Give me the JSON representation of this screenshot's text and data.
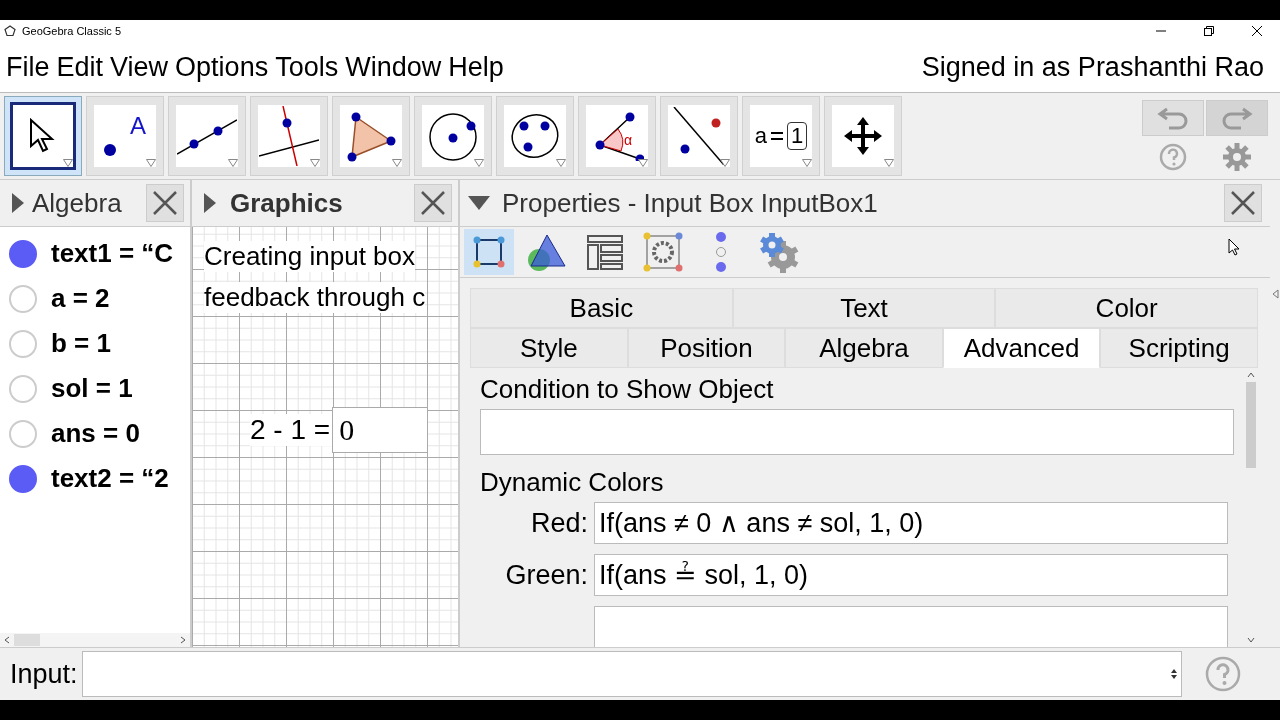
{
  "window": {
    "title": "GeoGebra Classic 5"
  },
  "menu": [
    "File",
    "Edit",
    "View",
    "Options",
    "Tools",
    "Window",
    "Help"
  ],
  "signed_in": "Signed in as Prashanthi Rao",
  "tools": [
    {
      "kind": "move",
      "selected": true
    },
    {
      "kind": "point",
      "label": "A",
      "selected": false
    },
    {
      "kind": "line",
      "selected": false
    },
    {
      "kind": "perpendicular",
      "selected": false
    },
    {
      "kind": "polygon",
      "selected": false
    },
    {
      "kind": "circle",
      "selected": false
    },
    {
      "kind": "conic",
      "selected": false
    },
    {
      "kind": "angle",
      "label": "α",
      "selected": false
    },
    {
      "kind": "reflect",
      "selected": false
    },
    {
      "kind": "slider",
      "label": "a",
      "value": "1",
      "selected": false
    },
    {
      "kind": "pan",
      "selected": false
    }
  ],
  "algebra": {
    "title": "Algebra",
    "items": [
      {
        "text": "text1 = “C",
        "visible": true
      },
      {
        "text": "a = 2",
        "visible": false
      },
      {
        "text": "b = 1",
        "visible": false
      },
      {
        "text": "sol = 1",
        "visible": false
      },
      {
        "text": "ans = 0",
        "visible": false
      },
      {
        "text": "text2 = “2",
        "visible": true
      }
    ]
  },
  "graphics": {
    "title": "Graphics",
    "lines": [
      "Creating input box",
      "feedback through c"
    ],
    "caption": "2 - 1 =",
    "input_value": "0"
  },
  "properties": {
    "title": "Properties - Input Box InputBox1",
    "views": [
      {
        "kind": "object",
        "selected": true
      },
      {
        "kind": "graphics",
        "selected": false
      },
      {
        "kind": "layout",
        "selected": false
      },
      {
        "kind": "defaults",
        "selected": false
      },
      {
        "kind": "algebra",
        "selected": false
      },
      {
        "kind": "advanced",
        "selected": false
      }
    ],
    "tab_rows": [
      [
        {
          "label": "Basic",
          "selected": false
        },
        {
          "label": "Text",
          "selected": false
        },
        {
          "label": "Color",
          "selected": false
        }
      ],
      [
        {
          "label": "Style",
          "selected": false
        },
        {
          "label": "Position",
          "selected": false
        },
        {
          "label": "Algebra",
          "selected": false
        },
        {
          "label": "Advanced",
          "selected": true
        },
        {
          "label": "Scripting",
          "selected": false
        }
      ]
    ],
    "condition_title": "Condition to Show Object",
    "dynamic_title": "Dynamic Colors",
    "colors": [
      {
        "label": "Red:",
        "value": "If(ans ≠ 0 ∧ ans ≠ sol, 1, 0)"
      },
      {
        "label": "Green:",
        "value": "If(ans ≟ sol, 1, 0)"
      }
    ]
  },
  "input_bar": {
    "label": "Input:"
  }
}
